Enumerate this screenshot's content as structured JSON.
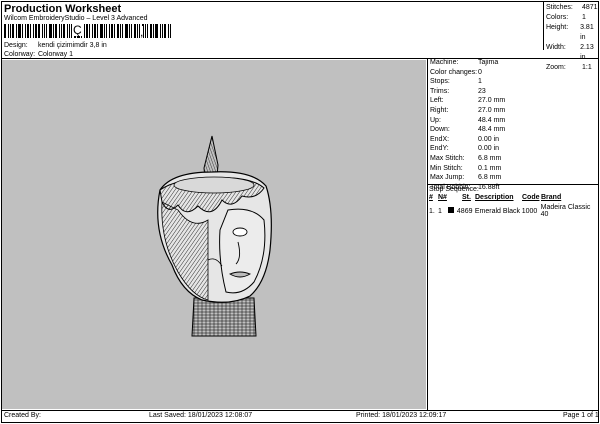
{
  "header": {
    "title": "Production Worksheet",
    "subtitle": "Wilcom EmbroideryStudio – Level 3 Advanced",
    "barcode_char": "Ç",
    "barcode_tail": ","
  },
  "design_info": {
    "design_label": "Design:",
    "design_value": "kendi çizimimdir 3,8 in",
    "colorway_label": "Colorway:",
    "colorway_value": "Colorway 1"
  },
  "summary": {
    "stitches_label": "Stitches:",
    "stitches_value": "4871",
    "colors_label": "Colors:",
    "colors_value": "1",
    "height_label": "Height:",
    "height_value": "3.81 in",
    "width_label": "Width:",
    "width_value": "2.13 in",
    "zoom_label": "Zoom:",
    "zoom_value": "1:1"
  },
  "specs": [
    {
      "label": "Machine:",
      "value": "Tajima"
    },
    {
      "label": "Color changes:",
      "value": "0"
    },
    {
      "label": "Stops:",
      "value": "1"
    },
    {
      "label": "Trims:",
      "value": "23"
    },
    {
      "label": "Left:",
      "value": "27.0 mm"
    },
    {
      "label": "Right:",
      "value": "27.0 mm"
    },
    {
      "label": "Up:",
      "value": "48.4 mm"
    },
    {
      "label": "Down:",
      "value": "48.4 mm"
    },
    {
      "label": "EndX:",
      "value": "0.00 in"
    },
    {
      "label": "EndY:",
      "value": "0.00 in"
    },
    {
      "label": "Max Stitch:",
      "value": "6.8 mm"
    },
    {
      "label": "Min Stitch:",
      "value": "0.1 mm"
    },
    {
      "label": "Max Jump:",
      "value": "6.8 mm"
    },
    {
      "label": "Total Bobbin:",
      "value": "16.88ft"
    }
  ],
  "stop_sequence": {
    "title": "Stop Sequence:",
    "headers": [
      "#",
      "N#",
      "St.",
      "Description",
      "Code",
      "Brand"
    ],
    "rows": [
      {
        "num": "1.",
        "n": "1",
        "st": "4869",
        "description": "Emerald Black",
        "code": "1000",
        "brand": "Madeira Classic 40",
        "swatch": "#000000"
      }
    ]
  },
  "footer": {
    "created_by": "Created By:",
    "last_saved": "Last Saved: 18/01/2023 12:08:07",
    "printed": "Printed: 18/01/2023 12:09:17",
    "page": "Page 1 of 1"
  },
  "colors": {
    "canvas_bg": "#c0c0c0",
    "stitch": "#000000"
  }
}
